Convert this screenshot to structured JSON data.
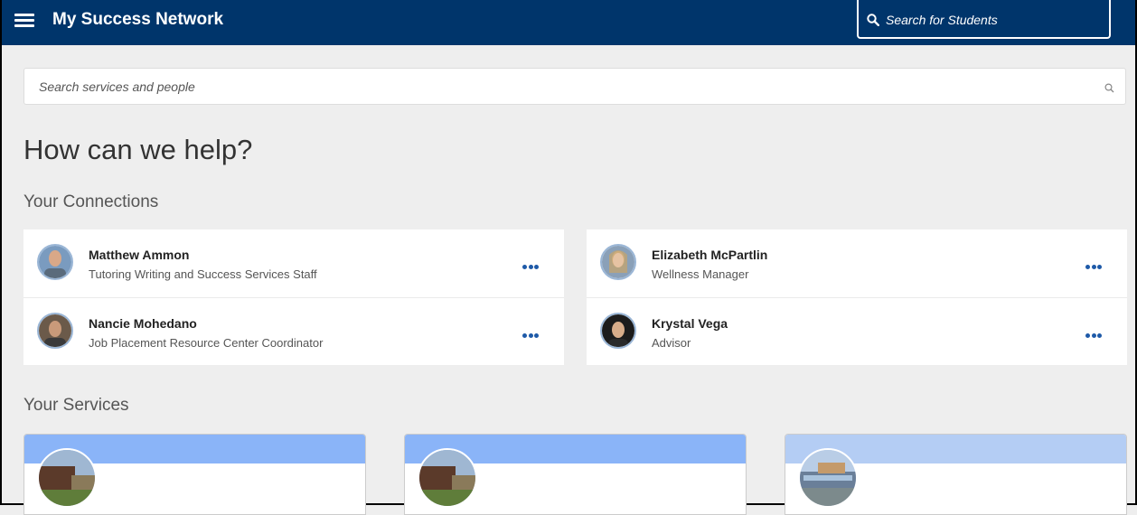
{
  "header": {
    "title": "My Success Network",
    "student_search_placeholder": "Search for Students",
    "bg_color": "#00356b"
  },
  "search": {
    "placeholder": "Search services and people"
  },
  "help_title": "How can we help?",
  "connections": {
    "title": "Your Connections",
    "items": [
      {
        "name": "Matthew Ammon",
        "role": "Tutoring Writing and Success Services Staff"
      },
      {
        "name": "Nancie Mohedano",
        "role": "Job Placement Resource Center Coordinator"
      },
      {
        "name": "Elizabeth McPartlin",
        "role": "Wellness Manager"
      },
      {
        "name": "Krystal Vega",
        "role": "Advisor"
      }
    ]
  },
  "services": {
    "title": "Your Services",
    "band_colors": [
      "#8ab4f8",
      "#8ab4f8",
      "#b4cdf4"
    ]
  }
}
